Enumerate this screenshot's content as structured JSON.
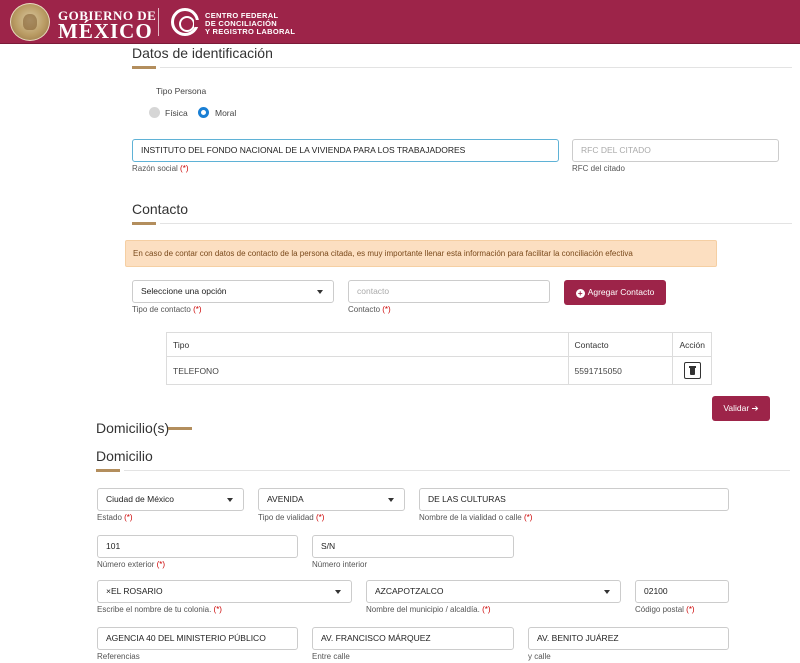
{
  "header": {
    "gov_line1": "GOBIERNO DE",
    "gov_line2": "MÉXICO",
    "org_line1": "CENTRO FEDERAL",
    "org_line2": "DE CONCILIACIÓN",
    "org_line3": "Y REGISTRO LABORAL"
  },
  "identificacion": {
    "title": "Datos de identificación",
    "tipo_persona_label": "Tipo Persona",
    "radio_fisica": "Física",
    "radio_moral": "Moral",
    "selected": "Moral",
    "razon_social_value": "INSTITUTO DEL FONDO NACIONAL DE LA VIVIENDA PARA LOS TRABAJADORES",
    "razon_social_label": "Razón social",
    "rfc_placeholder": "RFC DEL CITADO",
    "rfc_label": "RFC del citado"
  },
  "contacto": {
    "title": "Contacto",
    "alert": "En caso de contar con datos de contacto de la persona citada, es muy importante llenar esta información para facilitar la conciliación efectiva",
    "tipo_select_value": "Seleccione una opción",
    "tipo_label": "Tipo de contacto",
    "contacto_placeholder": "contacto",
    "contacto_label": "Contacto",
    "add_button": "Agregar Contacto",
    "table": {
      "headers": [
        "Tipo",
        "Contacto",
        "Acción"
      ],
      "rows": [
        {
          "tipo": "TELEFONO",
          "contacto": "5591715050"
        }
      ]
    },
    "validar_button": "Validar"
  },
  "required_mark": "(*)",
  "domicilios": {
    "title": "Domicilio(s)",
    "domicilio_title": "Domicilio",
    "estado_value": "Ciudad de México",
    "estado_label": "Estado",
    "tipo_vialidad_value": "AVENIDA",
    "tipo_vialidad_label": "Tipo de vialidad",
    "calle_value": "DE LAS CULTURAS",
    "calle_label": "Nombre de la vialidad o calle",
    "num_ext_value": "101",
    "num_ext_label": "Número exterior",
    "num_int_value": "S/N",
    "num_int_label": "Número interior",
    "colonia_value": "×EL ROSARIO",
    "colonia_label": "Escribe el nombre de tu colonia.",
    "municipio_value": "AZCAPOTZALCO",
    "municipio_label": "Nombre del municipio / alcaldía.",
    "cp_value": "02100",
    "cp_label": "Código postal",
    "referencias_value": "AGENCIA 40 DEL MINISTERIO PÚBLICO",
    "referencias_label": "Referencias",
    "entre_calle_value": "AV. FRANCISCO MÁRQUEZ",
    "entre_calle_label": "Entre calle",
    "y_calle_value": "AV. BENITO JUÁREZ",
    "y_calle_label": "y calle"
  },
  "colors": {
    "brand": "#9d2449",
    "accent_gold": "#b38e5d",
    "radio_selected": "#1a7fd4",
    "alert_bg": "#fcdfc1"
  }
}
